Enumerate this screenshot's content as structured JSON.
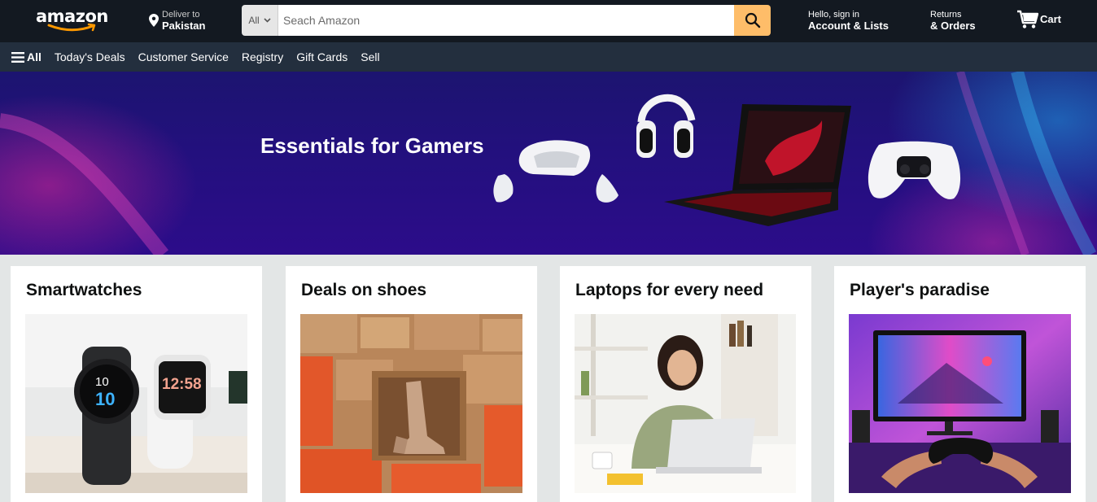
{
  "header": {
    "logo_text": "amazon",
    "deliver_line1": "Deliver to",
    "deliver_line2": "Pakistan",
    "search_category": "All",
    "search_placeholder": "Seach Amazon",
    "account_line1": "Hello, sign in",
    "account_line2": "Account & Lists",
    "returns_line1": "Returns",
    "returns_line2": "& Orders",
    "cart_label": "Cart"
  },
  "subnav": {
    "all_label": "All",
    "items": [
      "Today's Deals",
      "Customer Service",
      "Registry",
      "Gift Cards",
      "Sell"
    ]
  },
  "hero": {
    "title": "Essentials for Gamers"
  },
  "cards": [
    {
      "title": "Smartwatches",
      "watch_time_left": "10",
      "watch_time_left2": "10",
      "watch_time_right": "12:58"
    },
    {
      "title": "Deals on shoes"
    },
    {
      "title": "Laptops for every need"
    },
    {
      "title": "Player's paradise"
    }
  ],
  "icons": {
    "search": "search-icon",
    "location": "location-pin-icon",
    "cart": "cart-icon",
    "menu": "hamburger-menu-icon",
    "dropdown": "chevron-down-icon"
  },
  "colors": {
    "topbar": "#131921",
    "subnav": "#232f3e",
    "search_button": "#febd69",
    "page_bg": "#e3e6e6"
  }
}
